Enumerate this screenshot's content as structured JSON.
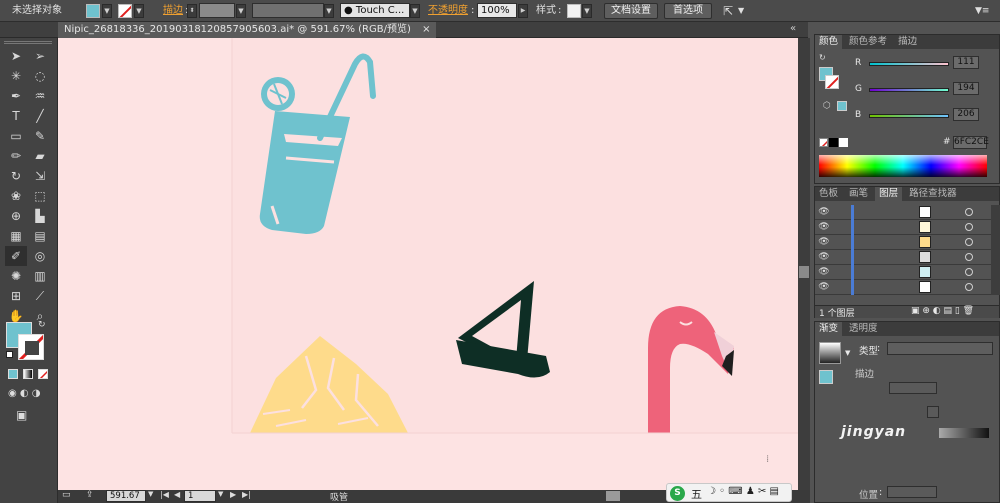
{
  "control_bar": {
    "selection_status": "未选择对象",
    "fill_color": "#6FC2CE",
    "stroke_label": "描边",
    "brush_name": "Touch C...",
    "opacity_label": "不透明度",
    "opacity_value": "100%",
    "style_label": "样式",
    "doc_setup_button": "文档设置",
    "prefs_button": "首选项"
  },
  "document_tab": {
    "title": "Nipic_26818336_20190318120857905603.ai* @ 591.67% (RGB/预览)",
    "close_glyph": "×"
  },
  "color_panel": {
    "tabs": [
      "颜色",
      "颜色参考",
      "描边"
    ],
    "r_label": "R",
    "r_value": "111",
    "g_label": "G",
    "g_value": "194",
    "b_label": "B",
    "b_value": "206",
    "hash": "#",
    "hex_value": "6FC2CE"
  },
  "layers_panel": {
    "tabs": [
      "色板",
      "画笔",
      "图层",
      "路径查找器"
    ],
    "footer_count": "1 个图层"
  },
  "gradient_panel": {
    "tabs": [
      "渐变",
      "透明度"
    ],
    "type_label": "类型",
    "stroke_label": "描边",
    "position_label": "位置"
  },
  "status_bar": {
    "zoom": "591.67",
    "page": "1",
    "tool_name": "吸管"
  },
  "ime_bar": {
    "mode": "五"
  },
  "watermark": "jingyan"
}
